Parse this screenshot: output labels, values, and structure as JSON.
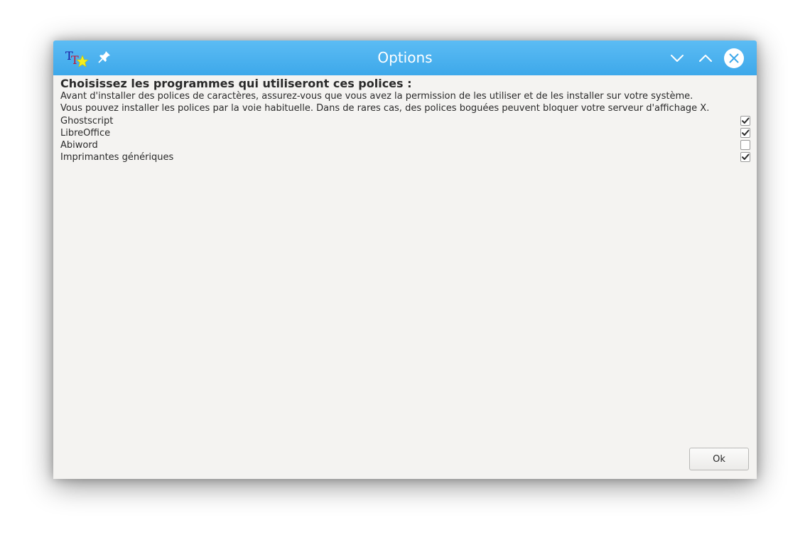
{
  "window": {
    "title": "Options"
  },
  "titlebar": {
    "icons": [
      "app-icon",
      "pin-icon",
      "minimize-icon",
      "maximize-icon",
      "close-icon"
    ],
    "accent_color": "#4ab3ef"
  },
  "content": {
    "heading": "Choisissez les programmes qui utiliseront ces polices :",
    "info_line1": "Avant d'installer des polices de caractères, assurez-vous que vous avez la permission de les utiliser et de les installer sur votre système.",
    "info_line2": "Vous pouvez installer les polices par la voie habituelle. Dans de rares cas, des polices boguées peuvent bloquer votre serveur d'affichage X.",
    "programs": [
      {
        "label": "Ghostscript",
        "checked": true
      },
      {
        "label": "LibreOffice",
        "checked": true
      },
      {
        "label": "Abiword",
        "checked": false
      },
      {
        "label": "Imprimantes génériques",
        "checked": true
      }
    ]
  },
  "footer": {
    "ok_label": "Ok"
  }
}
